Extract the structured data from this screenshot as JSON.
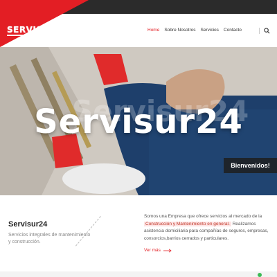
{
  "header": {
    "logo_text": "SERVISUR",
    "nav": [
      {
        "label": "Home"
      },
      {
        "label": "Sobre Nosotros"
      },
      {
        "label": "Servicios"
      },
      {
        "label": "Contacto"
      }
    ]
  },
  "hero": {
    "title": "Servisur24",
    "welcome": "Bienvenidos!"
  },
  "about": {
    "title": "Servisur24",
    "subtitle": "Servicios integrales de mantenimiento y construcción.",
    "text_before": "Somos una Empresa que ofrece servicios al mercado de la",
    "highlight": "Construcción y Mantenimiento en general.",
    "text_after": "Realizamos asistencia domiciliaria para compañías de seguros, empresas, consorcios,barrios cerrados y particulares.",
    "more_label": "Ver más"
  },
  "colors": {
    "accent": "#e31e24",
    "dark": "#2b2b2b"
  }
}
